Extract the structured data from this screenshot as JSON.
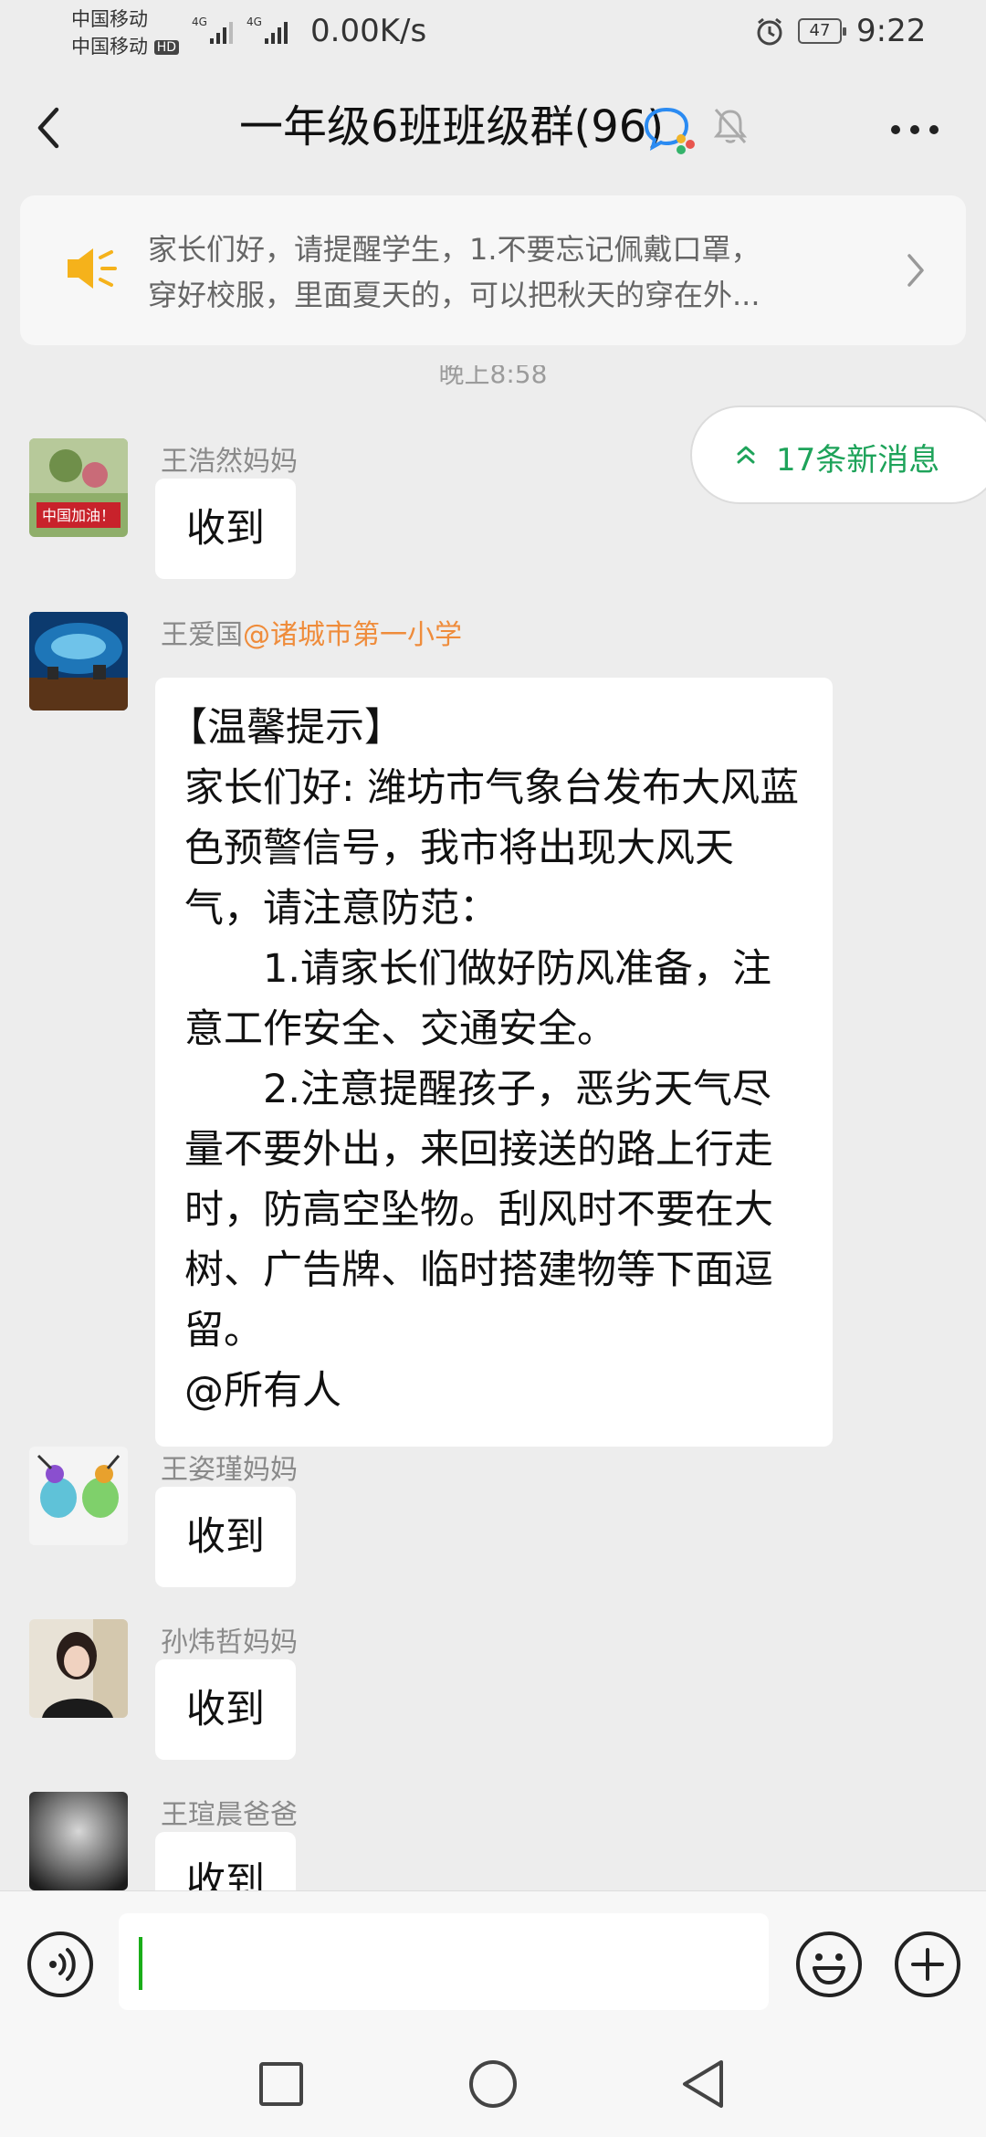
{
  "status_bar": {
    "carrier_1": "中国移动",
    "carrier_2": "中国移动",
    "hd_badge": "HD",
    "net_1": "4G",
    "net_2": "4G",
    "speed": "0.00K/s",
    "battery": "47",
    "time": "9:22"
  },
  "header": {
    "title": "一年级6班班级群(96)",
    "icons": [
      "back-icon",
      "group-chat-icon",
      "mute-bell-icon",
      "more-icon"
    ]
  },
  "announcement": {
    "line1": "家长们好，请提醒学生，1.不要忘记佩戴口罩，",
    "line2": "穿好校服，里面夏天的，可以把秋天的穿在外..."
  },
  "timestamp": "晚上8:58",
  "new_messages": "17条新消息",
  "messages": [
    {
      "sender": "王浩然妈妈",
      "text": "收到",
      "avatar_text": "中国加油！"
    },
    {
      "sender": "王爱国",
      "org": "@诸城市第一小学",
      "paragraphs": [
        "【温馨提示】",
        "家长们好: 潍坊市气象台发布大风蓝色预警信号，我市将出现大风天气，请注意防范：",
        "　　1.请家长们做好防风准备，注意工作安全、交通安全。",
        "　　2.注意提醒孩子，恶劣天气尽量不要外出，来回接送的路上行走时，防高空坠物。刮风时不要在大树、广告牌、临时搭建物等下面逗留。",
        "@所有人"
      ]
    },
    {
      "sender": "王姿瑾妈妈",
      "text": "收到"
    },
    {
      "sender": "孙炜哲妈妈",
      "text": "收到"
    },
    {
      "sender": "王瑄晨爸爸",
      "text": "收到"
    }
  ],
  "input": {
    "placeholder": ""
  },
  "colors": {
    "accent_green": "#1aad19",
    "new_msg_green": "#1ea35a",
    "org_orange": "#ef8c3b",
    "speaker_yellow": "#f5b21b"
  }
}
